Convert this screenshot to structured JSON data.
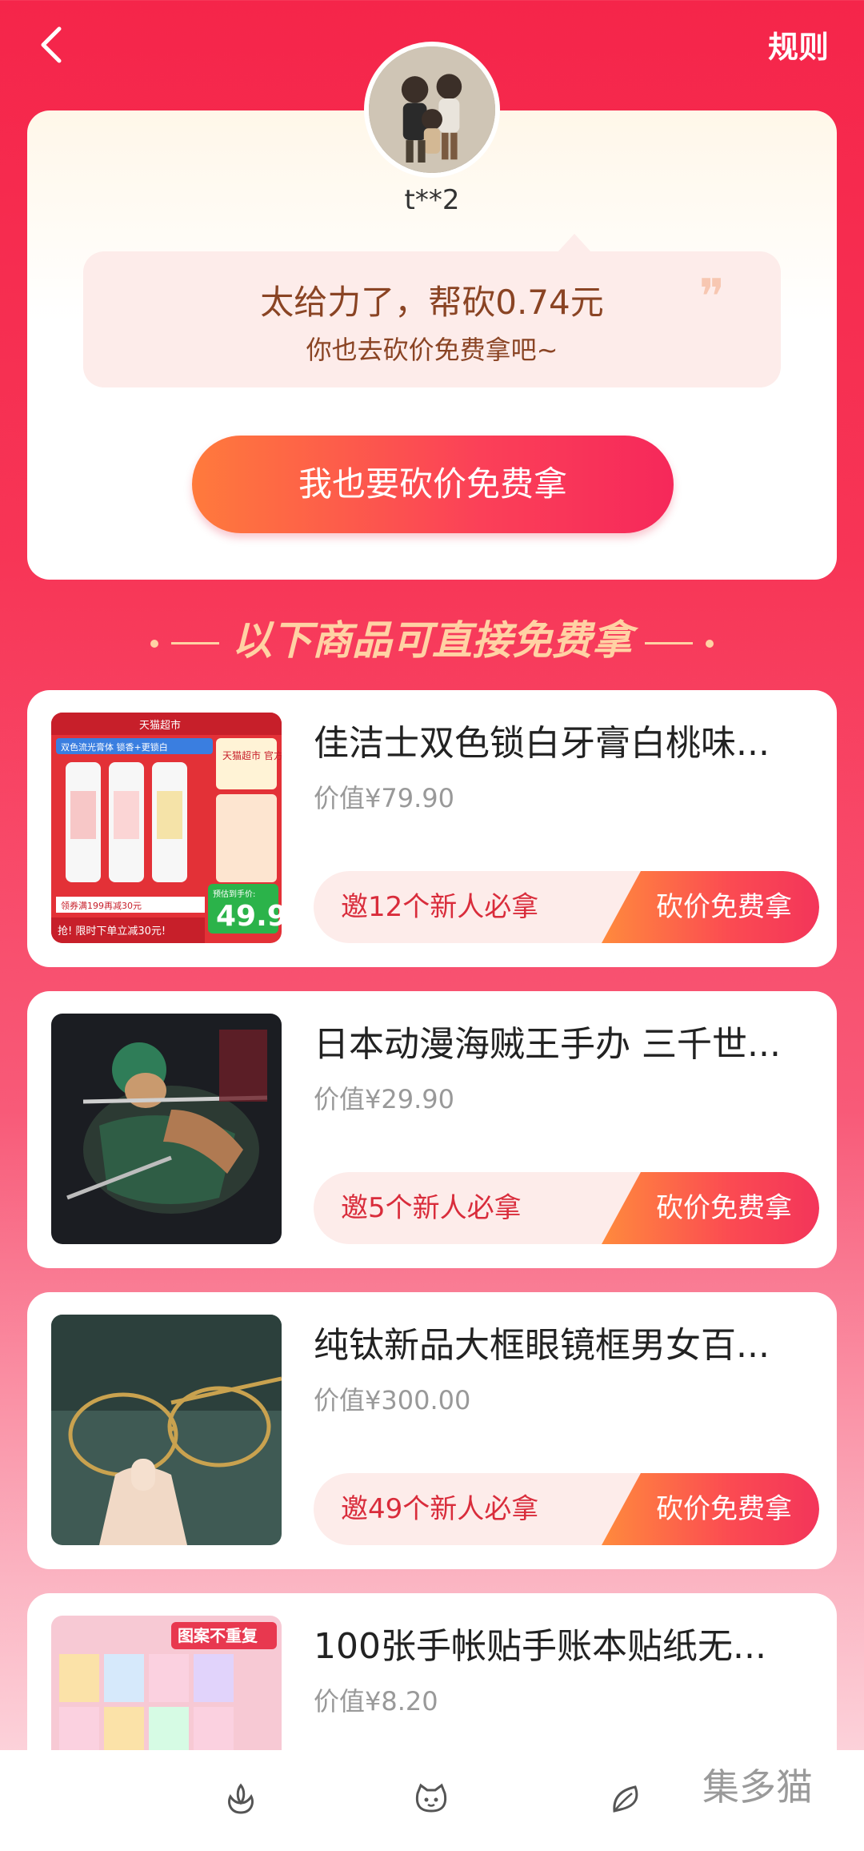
{
  "header": {
    "rules_label": "规则"
  },
  "user": {
    "name": "t**2"
  },
  "bubble": {
    "main": "太给力了，帮砍0.74元",
    "sub": "你也去砍价免费拿吧~"
  },
  "cta": {
    "label": "我也要砍价免费拿"
  },
  "section": {
    "title": "以下商品可直接免费拿"
  },
  "products": [
    {
      "title": "佳洁士双色锁白牙膏白桃味...",
      "price": "价值¥79.90",
      "invite": "邀12个新人必拿",
      "action": "砍价免费拿"
    },
    {
      "title": "日本动漫海贼王手办 三千世...",
      "price": "价值¥29.90",
      "invite": "邀5个新人必拿",
      "action": "砍价免费拿"
    },
    {
      "title": "纯钛新品大框眼镜框男女百...",
      "price": "价值¥300.00",
      "invite": "邀49个新人必拿",
      "action": "砍价免费拿"
    },
    {
      "title": "100张手帐贴手账本贴纸无...",
      "price": "价值¥8.20",
      "invite": "",
      "action": ""
    }
  ],
  "product_image_text": {
    "p1_top": "天猫超市",
    "p1_banner": "双色流光膏体 锁香+更锁白",
    "p1_official": "天猫超市 官方直发",
    "p1_price_label": "预估到手价:",
    "p1_price": "49.9",
    "p1_coupon": "领券满199再减30元",
    "p1_bottom": "抢! 限时下单立减30元!",
    "p4_banner": "图案不重复"
  },
  "brand_watermark": "集多猫",
  "colors": {
    "accent": "#f5254a",
    "cta_orange": "#ff7a3c",
    "invite_text": "#d92c3b"
  },
  "nav_icons": [
    "flower-icon",
    "cat-face-icon",
    "leaf-icon"
  ]
}
